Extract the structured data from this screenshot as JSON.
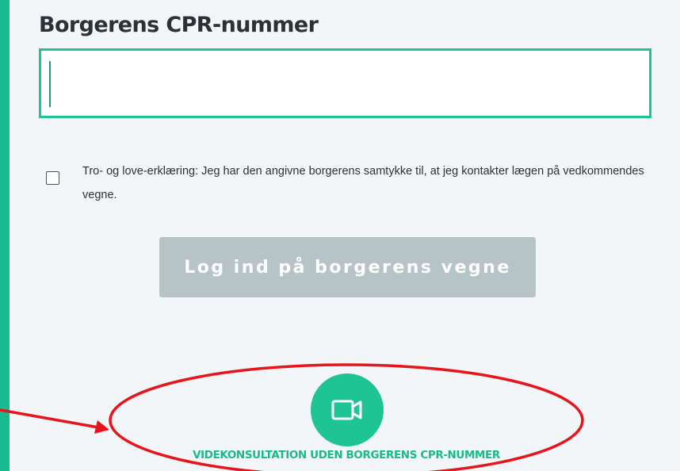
{
  "form": {
    "cpr_label": "Borgerens CPR-nummer",
    "cpr_value": "",
    "consent_checked": false,
    "consent_text": "Tro- og love-erklæring: Jeg har den angivne borgerens samtykke til, at jeg kontakter lægen på vedkommendes vegne.",
    "login_button_label": "Log ind på borgerens vegne",
    "login_button_enabled": false
  },
  "video": {
    "icon": "video-camera-icon",
    "link_label": "VIDEKONSULTATION UDEN BORGERENS CPR-NUMMER"
  },
  "colors": {
    "accent": "#1fc495",
    "page_border": "#1bb98f",
    "disabled_button": "#b6c3c7",
    "annotation_red": "#e8141c",
    "text": "#2a3238"
  }
}
